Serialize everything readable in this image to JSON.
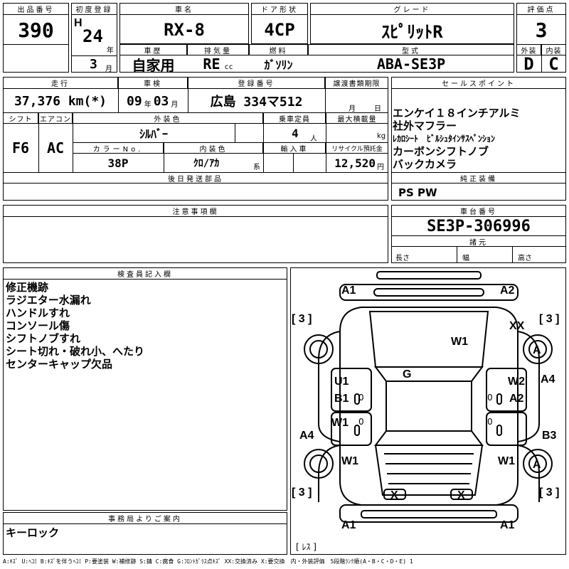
{
  "header": {
    "lot_no_label": "出品番号",
    "lot_no": "390",
    "first_reg_label": "初度登録",
    "era_prefix": "H",
    "first_reg_year": "24",
    "year_unit": "年",
    "first_reg_month": "3",
    "month_unit": "月",
    "car_name_label": "車名",
    "car_name": "RX-8",
    "door_label": "ドア形状",
    "door": "4CP",
    "grade_label": "グレード",
    "grade": "ｽﾋﾟﾘｯﾄR",
    "score_label": "評価点",
    "score": "3",
    "history_label": "車歴",
    "history": "自家用",
    "displacement_label": "排気量",
    "displacement": "RE",
    "displacement_unit": "cc",
    "fuel_label": "燃料",
    "fuel": "ｶﾞｿﾘﾝ",
    "model_label": "型式",
    "model": "ABA-SE3P",
    "exterior_label": "外装",
    "exterior": "D",
    "interior_label": "内装",
    "interior": "C"
  },
  "details": {
    "mileage_label": "走行",
    "mileage": "37,376 km(*)",
    "inspection_label": "車検",
    "inspection_year": "09",
    "inspection_year_unit": "年",
    "inspection_month": "03",
    "inspection_month_unit": "月",
    "plate_label": "登録番号",
    "plate": "広島 334マ512",
    "transfer_label": "譲渡書類期限",
    "transfer_month_unit": "月",
    "transfer_day_unit": "日",
    "shift_label": "シフト",
    "shift": "F6",
    "ac_label": "エアコン",
    "ac": "AC",
    "ext_color_label": "外装色",
    "ext_color": "ｼﾙﾊﾞｰ",
    "capacity_label": "乗車定員",
    "capacity": "4",
    "capacity_unit": "人",
    "max_load_label": "最大積載量",
    "max_load_unit": "kg",
    "color_no_label": "カラーNo.",
    "color_no": "38P",
    "int_color_label": "内装色",
    "int_color": "ｸﾛ/ｱｶ",
    "int_color_suffix": "系",
    "import_label": "輸入車",
    "recycle_label": "リサイクル預託金",
    "recycle": "12,520",
    "recycle_unit": "円",
    "later_parts_label": "後日発送部品"
  },
  "sales_points": {
    "label": "セールスポイント",
    "items": [
      "エンケイ１８インチアルミ",
      "社外マフラー",
      "ﾚｶﾛｼｰﾄ　ﾋﾞﾙｼｭﾀｲﾝｻｽﾍﾟﾝｼｮﾝ",
      "カーボンシフトノブ",
      "バックカメラ"
    ]
  },
  "equipment": {
    "label": "純正装備",
    "value": "PS PW"
  },
  "caution": {
    "label": "注意事項欄"
  },
  "chassis": {
    "label": "車台番号",
    "value": "SE3P-306996",
    "dims_label": "諸元",
    "length_label": "長さ",
    "width_label": "幅",
    "height_label": "高さ"
  },
  "inspector": {
    "label": "検査員記入欄",
    "notes": [
      "修正機跡",
      "ラジエター水漏れ",
      "ハンドルすれ",
      "コンソール傷",
      "シフトノブすれ",
      "シート切れ・破れ小、へたり",
      "センターキャップ欠品"
    ]
  },
  "office": {
    "label": "事務局よりご案内",
    "note": "キーロック"
  },
  "diagram": {
    "marks": {
      "front_left_bumper": "A1",
      "front_right_bumper": "A2",
      "bracket_fl": "[ 3 ]",
      "bracket_fr": "[ 3 ]",
      "bracket_rl": "[ 3 ]",
      "bracket_rr": "[ 3 ]",
      "hood": "W1",
      "windshield": "XX",
      "front_right_wheel": "A",
      "roof": "G",
      "left_front_door_top": "U1",
      "left_front_door_bottom": "B1",
      "right_front_door_top": "W2",
      "right_front_door_bottom": "A2",
      "right_front_side": "A4",
      "left_rear_side": "A4",
      "right_rear_side": "B3",
      "left_rear_door": "W1",
      "left_rear_fender": "W1",
      "right_rear_fender": "W1",
      "rear_right_wheel": "A",
      "rear_lamp_left": "X",
      "rear_lamp_right": "X",
      "rear_left_bumper": "A1",
      "rear_right_bumper": "A1",
      "less_label": "[ ﾚｽ ]"
    }
  },
  "legend": "A:ｷｽﾞ U:ﾍｺﾐ B:ｷｽﾞを伴うﾍｺﾐ P:要塗装 W:補修跡 S:錆 C:腐食 G:ﾌﾛﾝﾄｶﾞﾗｽ点ｷｽﾞ XX:交換済み X:要交換　内・外装評価　5段階ﾗﾝｸ順(A・B・C・D・E) 1"
}
